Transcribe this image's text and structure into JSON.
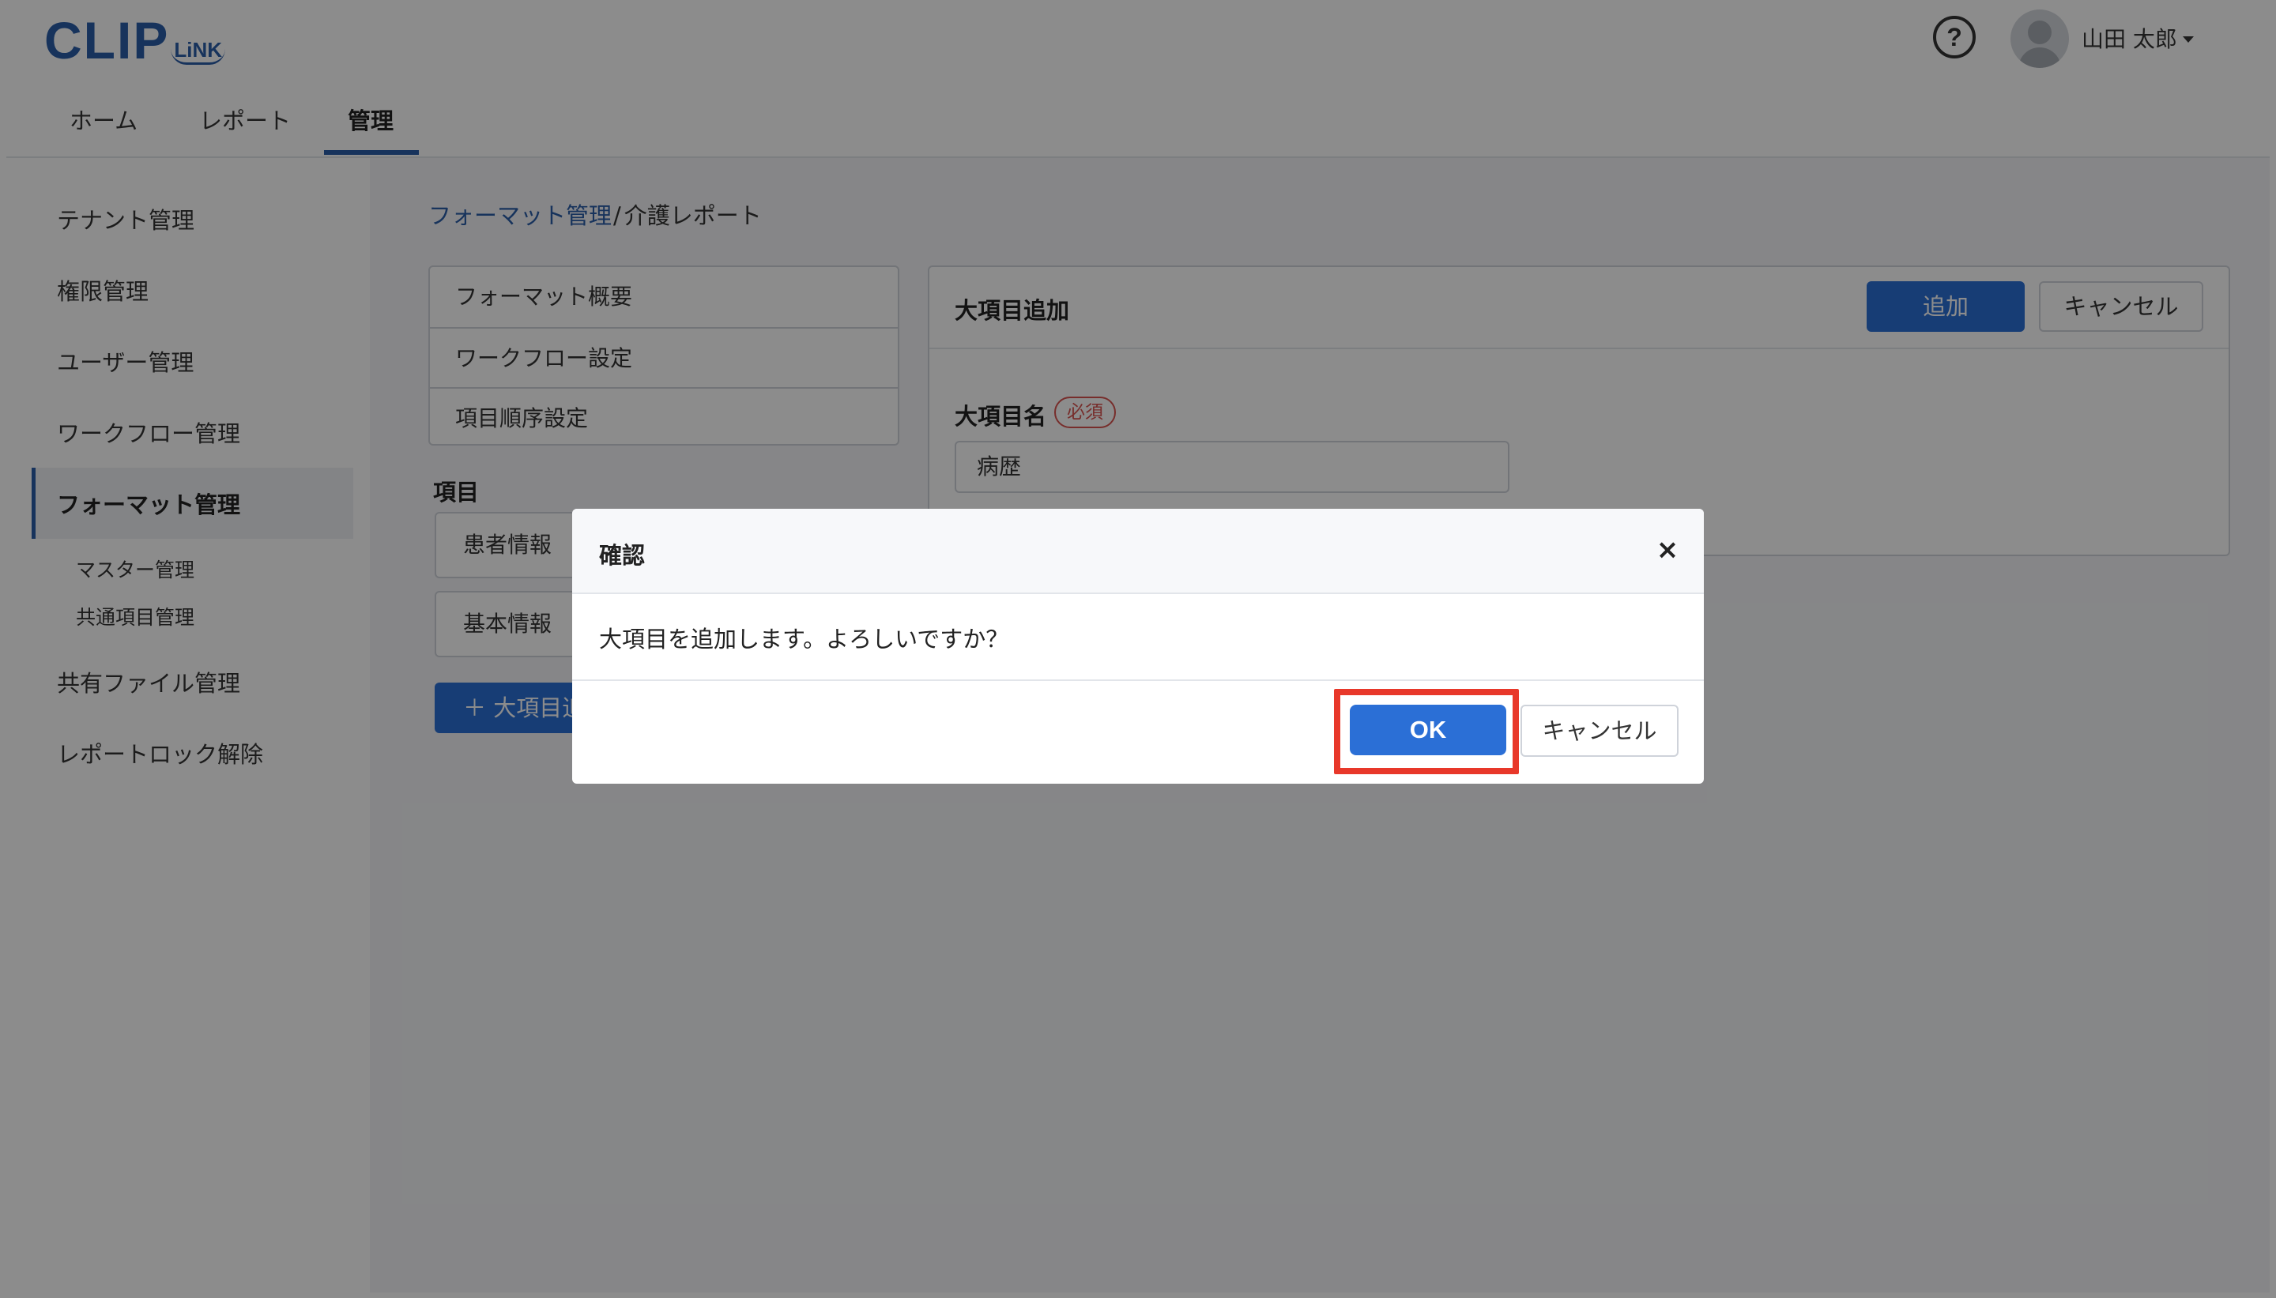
{
  "header": {
    "logo_main": "CLIP",
    "logo_sub": "LiNK",
    "help_symbol": "?",
    "user_name": "山田 太郎",
    "nav_tabs": [
      {
        "label": "ホーム"
      },
      {
        "label": "レポート"
      },
      {
        "label": "管理",
        "active": true
      }
    ]
  },
  "sidebar": {
    "items": [
      {
        "label": "テナント管理"
      },
      {
        "label": "権限管理"
      },
      {
        "label": "ユーザー管理"
      },
      {
        "label": "ワークフロー管理"
      },
      {
        "label": "フォーマット管理",
        "active": true
      },
      {
        "label": "共有ファイル管理"
      },
      {
        "label": "レポートロック解除"
      }
    ],
    "sub_items": [
      {
        "label": "マスター管理"
      },
      {
        "label": "共通項目管理"
      }
    ]
  },
  "breadcrumb": {
    "link": "フォーマット管理",
    "separator": "/",
    "current": "介護レポート"
  },
  "format_menu": [
    {
      "label": "フォーマット概要"
    },
    {
      "label": "ワークフロー設定"
    },
    {
      "label": "項目順序設定"
    }
  ],
  "items_section": {
    "title": "項目",
    "cards": [
      {
        "label": "患者情報"
      },
      {
        "label": "基本情報"
      }
    ],
    "add_button": "＋ 大項目追加"
  },
  "panel": {
    "title": "大項目追加",
    "add_button": "追加",
    "cancel_button": "キャンセル",
    "field_label": "大項目名",
    "required_badge": "必須",
    "field_value": "病歴"
  },
  "dialog": {
    "title": "確認",
    "close_symbol": "×",
    "message": "大項目を追加します。よろしいですか？",
    "ok_label": "OK",
    "cancel_label": "キャンセル"
  },
  "colors": {
    "brand": "#2b5da8",
    "primary_button": "#2b6fd6",
    "required": "#d9534f",
    "highlight": "#e8382a",
    "overlay": "rgba(0,0,0,0.45)"
  }
}
